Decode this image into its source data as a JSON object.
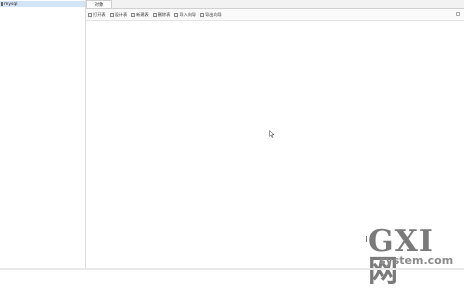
{
  "sidebar": {
    "connection_label": "mysql"
  },
  "tabs": [
    {
      "label": "对象"
    }
  ],
  "toolbar": {
    "buttons": [
      {
        "icon": "open-table-icon",
        "label": "打开表"
      },
      {
        "icon": "design-table-icon",
        "label": "设计表"
      },
      {
        "icon": "new-table-icon",
        "label": "新建表"
      },
      {
        "icon": "delete-table-icon",
        "label": "删除表"
      },
      {
        "icon": "import-wizard-icon",
        "label": "导入向导"
      },
      {
        "icon": "export-wizard-icon",
        "label": "导出向导"
      }
    ]
  },
  "watermark": {
    "logo": "GXI网",
    "site": "system.com"
  },
  "colors": {
    "selected_row": "#d4e4f7",
    "border": "#dadada"
  }
}
